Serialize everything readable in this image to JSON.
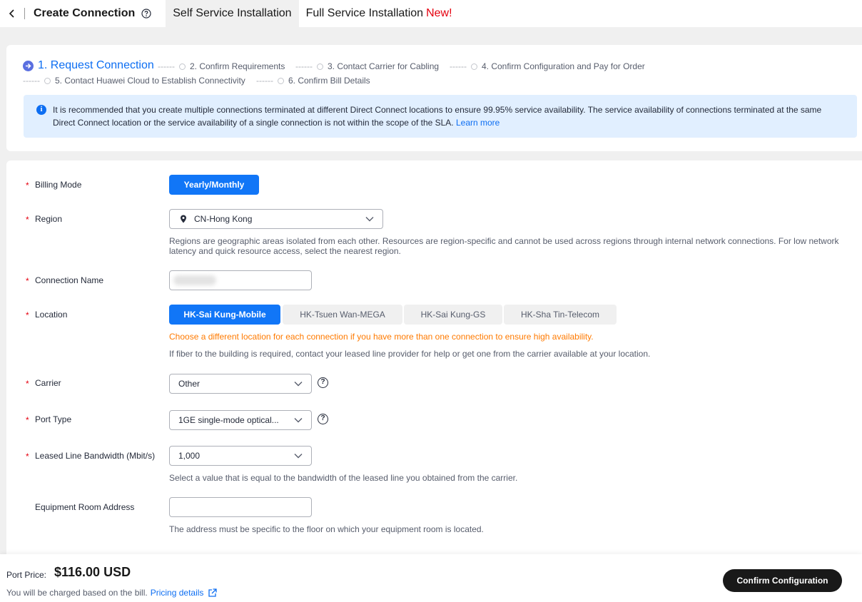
{
  "header": {
    "title": "Create Connection",
    "tabs": [
      {
        "label": "Self Service Installation"
      },
      {
        "label": "Full Service Installation"
      }
    ],
    "new_badge": "New!"
  },
  "steps": [
    {
      "label": "1. Request Connection",
      "active": true
    },
    {
      "label": "2. Confirm Requirements"
    },
    {
      "label": "3. Contact Carrier for Cabling"
    },
    {
      "label": "4. Confirm Configuration and Pay for Order"
    },
    {
      "label": "5. Contact Huawei Cloud to Establish Connectivity"
    },
    {
      "label": "6. Confirm Bill Details"
    }
  ],
  "step_separator": "------",
  "notice": {
    "text": "It is recommended that you create multiple connections terminated at different Direct Connect locations to ensure 99.95% service availability. The service availability of connections terminated at the same Direct Connect location or the service availability of a single connection is not within the scope of the SLA.",
    "link": "Learn more"
  },
  "form": {
    "required_mark": "*",
    "billing_mode": {
      "label": "Billing Mode",
      "value": "Yearly/Monthly"
    },
    "region": {
      "label": "Region",
      "value": "CN-Hong Kong",
      "hint": "Regions are geographic areas isolated from each other. Resources are region-specific and cannot be used across regions through internal network connections. For low network latency and quick resource access, select the nearest region."
    },
    "connection_name": {
      "label": "Connection Name"
    },
    "location": {
      "label": "Location",
      "options": [
        "HK-Sai Kung-Mobile",
        "HK-Tsuen Wan-MEGA",
        "HK-Sai Kung-GS",
        "HK-Sha Tin-Telecom"
      ],
      "selected": "HK-Sai Kung-Mobile",
      "warning": "Choose a different location for each connection if you have more than one connection to ensure high availability.",
      "hint": "If fiber to the building is required, contact your leased line provider for help or get one from the carrier available at your location."
    },
    "carrier": {
      "label": "Carrier",
      "value": "Other"
    },
    "port_type": {
      "label": "Port Type",
      "value": "1GE single-mode optical..."
    },
    "bandwidth": {
      "label": "Leased Line Bandwidth (Mbit/s)",
      "value": "1,000",
      "hint": "Select a value that is equal to the bandwidth of the leased line you obtained from the carrier."
    },
    "equipment_room": {
      "label": "Equipment Room Address",
      "hint": "The address must be specific to the floor on which your equipment room is located."
    }
  },
  "footer": {
    "price_label": "Port Price:",
    "price": "$116.00 USD",
    "note": "You will be charged based on the bill.",
    "pricing_link": "Pricing details",
    "confirm_label": "Confirm Configuration"
  },
  "colors": {
    "accent": "#1176f7",
    "warning": "#ff7a00",
    "required": "#e5000f",
    "notice_bg": "#e1efff"
  }
}
